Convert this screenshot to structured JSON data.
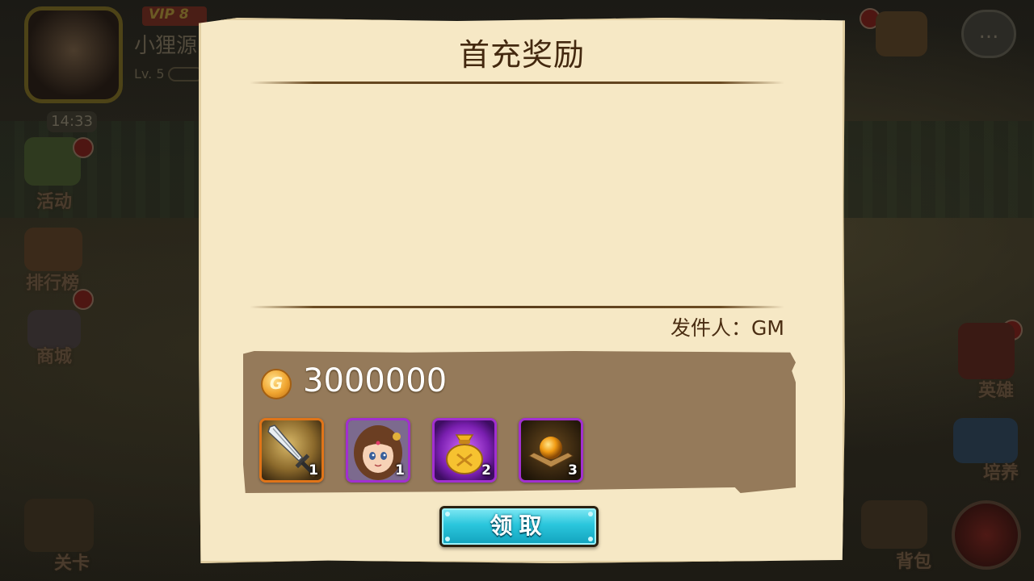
{
  "hud": {
    "vip_label": "VIP 8",
    "player_name": "小狸源",
    "level": "Lv. 5",
    "clock": "14:33",
    "side_left": [
      "活动",
      "排行榜",
      "商城",
      "关卡"
    ],
    "side_right": [
      "英雄",
      "培养",
      "背包"
    ],
    "chat": "..."
  },
  "dialog": {
    "title": "首充奖励",
    "body": "",
    "sender": "发件人：GM"
  },
  "rewards": {
    "coin_amount": "3000000",
    "coin_symbol": "G",
    "items": [
      {
        "icon": "sword-icon",
        "quantity": "1",
        "frame": "orange"
      },
      {
        "icon": "hero-girl-portrait",
        "quantity": "1",
        "frame": "purple"
      },
      {
        "icon": "gold-bag-icon",
        "quantity": "2",
        "frame": "purple"
      },
      {
        "icon": "orb-icon",
        "quantity": "3",
        "frame": "purple"
      }
    ]
  },
  "claim_button": {
    "label": "领取"
  },
  "colors": {
    "parchment": "#f6e8c5",
    "panel": "#957a5a",
    "claim_button": "#2ac6dc",
    "frame_purple": "#a12fd0",
    "frame_orange": "#e07418"
  }
}
